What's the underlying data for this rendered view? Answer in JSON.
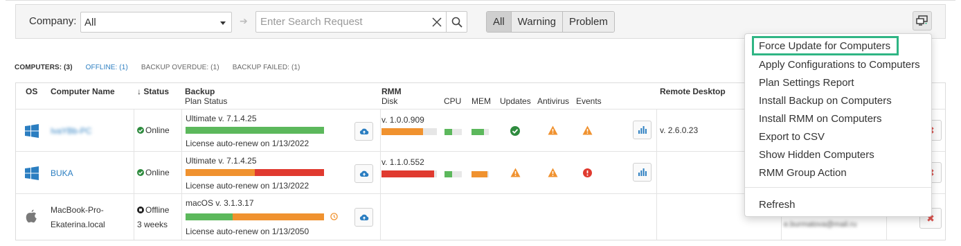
{
  "filter": {
    "company_label": "Company:",
    "company_value": "All",
    "search_placeholder": "Enter Search Request",
    "status_filters": [
      "All",
      "Warning",
      "Problem"
    ]
  },
  "tabs": {
    "computers": "COMPUTERS: (3)",
    "offline": "OFFLINE: (1)",
    "backup_overdue": "BACKUP OVERDUE: (1)",
    "backup_failed": "BACKUP FAILED: (1)"
  },
  "columns": {
    "os": "OS",
    "computer_name": "Computer Name",
    "status": "↓ Status",
    "backup": "Backup",
    "plan_status": "Plan Status",
    "rmm": "RMM",
    "disk": "Disk",
    "cpu": "CPU",
    "mem": "MEM",
    "updates": "Updates",
    "antivirus": "Antivirus",
    "events": "Events",
    "remote_desktop": "Remote Desktop"
  },
  "rows": [
    {
      "os": "windows-icon",
      "name": "IvaYBb-PC",
      "status": "Online",
      "backup_version": "Ultimate v. 7.1.4.25",
      "license": "License auto-renew on 1/13/2022",
      "backup_bar": [
        {
          "color": "#5cb85c",
          "value": 1.0
        }
      ],
      "rmm_version": "v. 1.0.0.909",
      "disk_fill": 0.75,
      "disk_color": "#f0922f",
      "cpu_fill": 0.45,
      "mem_fill": 0.7,
      "updates": "ok",
      "antivirus": "warning",
      "events": "warning",
      "remote_desktop": "v. 2.6.0.23"
    },
    {
      "os": "windows-icon",
      "name": "BUKA",
      "status": "Online",
      "backup_version": "Ultimate v. 7.1.4.25",
      "license": "License auto-renew on 1/13/2022",
      "backup_bar": [
        {
          "color": "#f0922f",
          "value": 0.5
        },
        {
          "color": "#e03a2f",
          "value": 0.5
        }
      ],
      "rmm_version": "v. 1.1.0.552",
      "disk_fill": 0.95,
      "disk_color": "#e03a2f",
      "cpu_fill": 0.45,
      "mem_fill": 0.9,
      "updates": "warning",
      "antivirus": "warning",
      "events": "error",
      "remote_desktop": ""
    },
    {
      "os": "apple-icon",
      "name_line1": "MacBook-Pro-",
      "name_line2": "Ekaterina.local",
      "status": "Offline",
      "status_sub": "3 weeks",
      "backup_version": "macOS v. 3.1.3.17",
      "license": "License auto-renew on 1/13/2050",
      "backup_bar": [
        {
          "color": "#5cb85c",
          "value": 0.34
        },
        {
          "color": "#f0922f",
          "value": 0.66
        }
      ],
      "email": "e.burmatova@mail.ru"
    }
  ],
  "menu": {
    "items": [
      "Force Update for Computers",
      "Apply Configurations to Computers",
      "Plan Settings Report",
      "Install Backup on Computers",
      "Install RMM on Computers",
      "Export to CSV",
      "Show Hidden Computers",
      "RMM Group Action"
    ],
    "refresh": "Refresh"
  },
  "colors": {
    "accent": "#2b7ec1",
    "success": "#5cb85c",
    "warning": "#f0922f",
    "danger": "#e03a2f",
    "menu_highlight": "#2fb584"
  }
}
